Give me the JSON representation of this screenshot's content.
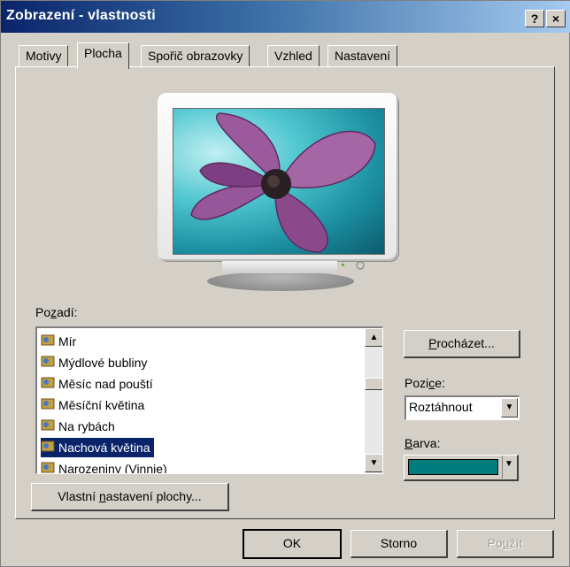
{
  "window": {
    "title": "Zobrazení - vlastnosti",
    "help_label": "?",
    "close_label": "×"
  },
  "tabs": [
    {
      "label": "Motivy",
      "active": false
    },
    {
      "label": "Plocha",
      "active": true
    },
    {
      "label": "Spořič obrazovky",
      "active": false
    },
    {
      "label": "Vzhled",
      "active": false
    },
    {
      "label": "Nastavení",
      "active": false
    }
  ],
  "desktop": {
    "background_label_pre": "Po",
    "background_label_acc": "z",
    "background_label_post": "adí:",
    "wallpapers": [
      {
        "label": "Mír",
        "selected": false
      },
      {
        "label": "Mýdlové bubliny",
        "selected": false
      },
      {
        "label": "Měsíc nad pouští",
        "selected": false
      },
      {
        "label": "Měsíční květina",
        "selected": false
      },
      {
        "label": "Na rybách",
        "selected": false
      },
      {
        "label": "Nachová květina",
        "selected": true
      },
      {
        "label": "Narozeniny (Vinnie)",
        "selected": false
      }
    ],
    "browse_pre": "",
    "browse_acc": "P",
    "browse_post": "rocházet...",
    "position_pre": "Pozi",
    "position_acc": "c",
    "position_post": "e:",
    "position_value": "Roztáhnout",
    "color_pre": "",
    "color_acc": "B",
    "color_post": "arva:",
    "color_value": "#007c7c",
    "customize_pre": "Vlastní ",
    "customize_acc": "n",
    "customize_post": "astavení plochy..."
  },
  "footer": {
    "ok_label": "OK",
    "cancel_label": "Storno",
    "apply_pre": "Po",
    "apply_acc": "u",
    "apply_post": "žít"
  },
  "icons": {
    "scroll_up": "scroll-up-arrow-icon",
    "scroll_down": "scroll-down-arrow-icon",
    "dropdown": "dropdown-arrow-icon",
    "wallpaper": "wallpaper-file-icon"
  }
}
